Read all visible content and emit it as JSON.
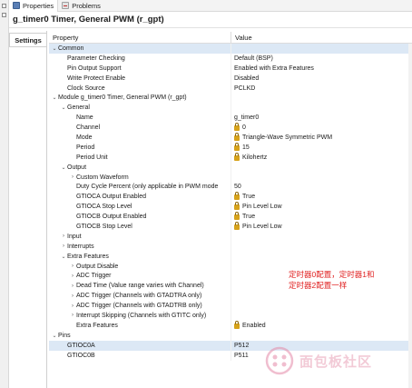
{
  "window": {
    "tabs": [
      {
        "label": "Properties",
        "icon": "properties-icon",
        "active": true
      },
      {
        "label": "Problems",
        "icon": "problems-icon",
        "active": false
      }
    ],
    "title": "g_timer0 Timer, General PWM (r_gpt)"
  },
  "side_tabs": [
    "Settings"
  ],
  "table": {
    "headers": [
      "Property",
      "Value"
    ],
    "rows": [
      {
        "label": "Common",
        "value": "",
        "level": 0,
        "twisty": "expanded",
        "lock": false,
        "selected": true
      },
      {
        "label": "Parameter Checking",
        "value": "Default (BSP)",
        "level": 1,
        "twisty": "",
        "lock": false
      },
      {
        "label": "Pin Output Support",
        "value": "Enabled with Extra Features",
        "level": 1,
        "twisty": "",
        "lock": false
      },
      {
        "label": "Write Protect Enable",
        "value": "Disabled",
        "level": 1,
        "twisty": "",
        "lock": false
      },
      {
        "label": "Clock Source",
        "value": "PCLKD",
        "level": 1,
        "twisty": "",
        "lock": false
      },
      {
        "label": "Module g_timer0 Timer, General PWM (r_gpt)",
        "value": "",
        "level": 0,
        "twisty": "expanded",
        "lock": false
      },
      {
        "label": "General",
        "value": "",
        "level": 1,
        "twisty": "expanded",
        "lock": false
      },
      {
        "label": "Name",
        "value": "g_timer0",
        "level": 2,
        "twisty": "",
        "lock": false
      },
      {
        "label": "Channel",
        "value": "0",
        "level": 2,
        "twisty": "",
        "lock": true
      },
      {
        "label": "Mode",
        "value": "Triangle-Wave Symmetric PWM",
        "level": 2,
        "twisty": "",
        "lock": true
      },
      {
        "label": "Period",
        "value": "15",
        "level": 2,
        "twisty": "",
        "lock": true
      },
      {
        "label": "Period Unit",
        "value": "Kilohertz",
        "level": 2,
        "twisty": "",
        "lock": true
      },
      {
        "label": "Output",
        "value": "",
        "level": 1,
        "twisty": "expanded",
        "lock": false
      },
      {
        "label": "Custom Waveform",
        "value": "",
        "level": 2,
        "twisty": "collapsed",
        "lock": false
      },
      {
        "label": "Duty Cycle Percent (only applicable in PWM mode",
        "value": "50",
        "level": 2,
        "twisty": "",
        "lock": false
      },
      {
        "label": "GTIOCA Output Enabled",
        "value": "True",
        "level": 2,
        "twisty": "",
        "lock": true
      },
      {
        "label": "GTIOCA Stop Level",
        "value": "Pin Level Low",
        "level": 2,
        "twisty": "",
        "lock": true
      },
      {
        "label": "GTIOCB Output Enabled",
        "value": "True",
        "level": 2,
        "twisty": "",
        "lock": true
      },
      {
        "label": "GTIOCB Stop Level",
        "value": "Pin Level Low",
        "level": 2,
        "twisty": "",
        "lock": true
      },
      {
        "label": "Input",
        "value": "",
        "level": 1,
        "twisty": "collapsed",
        "lock": false
      },
      {
        "label": "Interrupts",
        "value": "",
        "level": 1,
        "twisty": "collapsed",
        "lock": false
      },
      {
        "label": "Extra Features",
        "value": "",
        "level": 1,
        "twisty": "expanded",
        "lock": false
      },
      {
        "label": "Output Disable",
        "value": "",
        "level": 2,
        "twisty": "collapsed",
        "lock": false
      },
      {
        "label": "ADC Trigger",
        "value": "",
        "level": 2,
        "twisty": "collapsed",
        "lock": false
      },
      {
        "label": "Dead Time (Value range varies with Channel)",
        "value": "",
        "level": 2,
        "twisty": "collapsed",
        "lock": false
      },
      {
        "label": "ADC Trigger (Channels with GTADTRA only)",
        "value": "",
        "level": 2,
        "twisty": "collapsed",
        "lock": false
      },
      {
        "label": "ADC Trigger (Channels with GTADTRB only)",
        "value": "",
        "level": 2,
        "twisty": "collapsed",
        "lock": false
      },
      {
        "label": "Interrupt Skipping (Channels with GTITC only)",
        "value": "",
        "level": 2,
        "twisty": "collapsed",
        "lock": false
      },
      {
        "label": "Extra Features",
        "value": "Enabled",
        "level": 2,
        "twisty": "",
        "lock": true
      },
      {
        "label": "Pins",
        "value": "",
        "level": 0,
        "twisty": "expanded",
        "lock": false
      },
      {
        "label": "GTIOC0A",
        "value": "P512",
        "level": 1,
        "twisty": "",
        "lock": false,
        "selected": true
      },
      {
        "label": "GTIOC0B",
        "value": "P511",
        "level": 1,
        "twisty": "",
        "lock": false
      }
    ]
  },
  "annotation": {
    "line1": "定时器0配置，定时器1和",
    "line2": "定时器2配置一样"
  },
  "watermark": {
    "text": "面包板社区"
  },
  "colors": {
    "annotation": "#e02020",
    "selection": "#dce8f5",
    "lock": "#d6a21a"
  }
}
